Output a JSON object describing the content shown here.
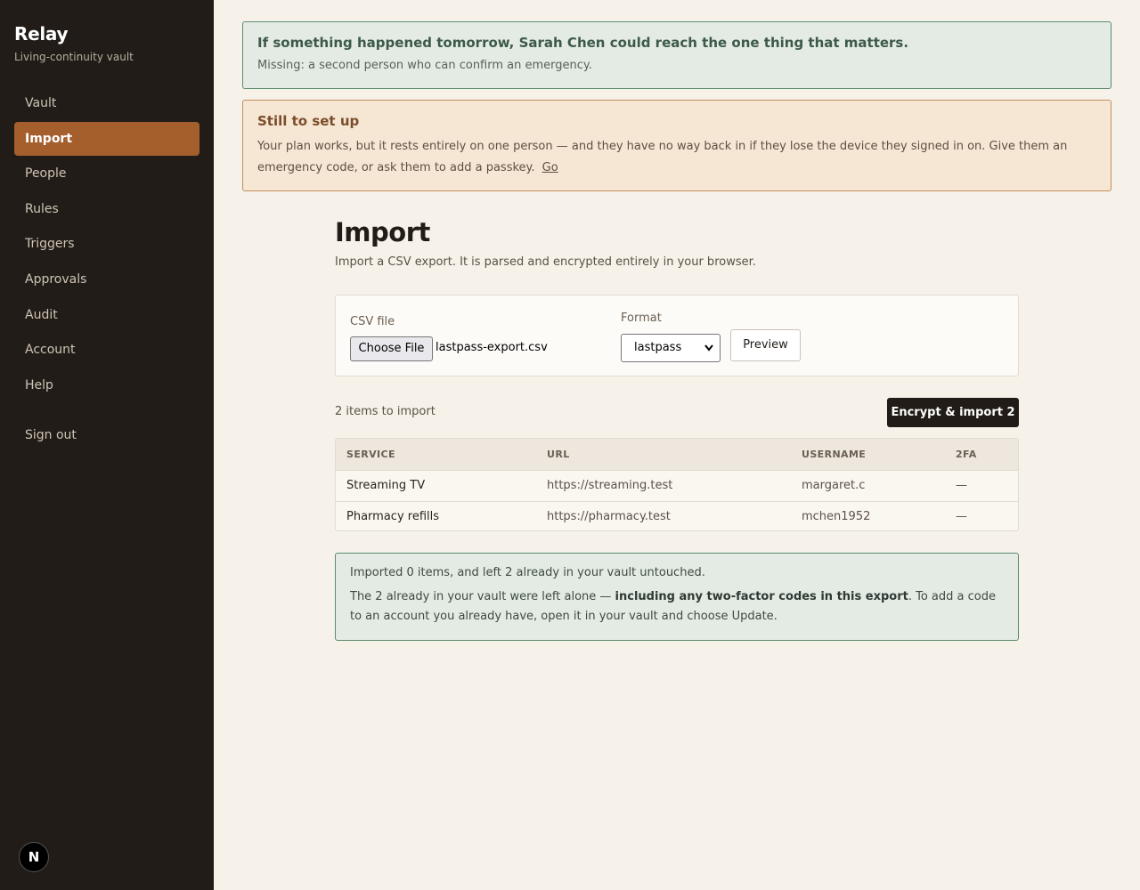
{
  "sidebar": {
    "brand": "Relay",
    "tagline": "Living-continuity vault",
    "items": [
      {
        "label": "Vault"
      },
      {
        "label": "Import",
        "active": true
      },
      {
        "label": "People"
      },
      {
        "label": "Rules"
      },
      {
        "label": "Triggers"
      },
      {
        "label": "Approvals"
      },
      {
        "label": "Audit"
      },
      {
        "label": "Account"
      },
      {
        "label": "Help"
      }
    ],
    "sign_out": "Sign out",
    "badge": "N"
  },
  "banners": {
    "status": {
      "heading": "If something happened tomorrow, Sarah Chen could reach the one thing that matters.",
      "sub": "Missing: a second person who can confirm an emergency."
    },
    "setup": {
      "heading": "Still to set up",
      "body": "Your plan works, but it rests entirely on one person — and they have no way back in if they lose the device they signed in on. Give them an emergency code, or ask them to add a passkey.",
      "link": "Go"
    }
  },
  "page": {
    "title": "Import",
    "description": "Import a CSV export. It is parsed and encrypted entirely in your browser."
  },
  "form": {
    "csv_label": "CSV file",
    "file_button": "Choose File",
    "file_name": "lastpass-export.csv",
    "format_label": "Format",
    "format_value": "lastpass",
    "preview_button": "Preview"
  },
  "import": {
    "count_text": "2 items to import",
    "encrypt_button": "Encrypt & import 2"
  },
  "table": {
    "headers": [
      "SERVICE",
      "URL",
      "USERNAME",
      "2FA"
    ],
    "rows": [
      {
        "service": "Streaming TV",
        "url": "https://streaming.test",
        "username": "margaret.c",
        "twofa": "—"
      },
      {
        "service": "Pharmacy refills",
        "url": "https://pharmacy.test",
        "username": "mchen1952",
        "twofa": "—"
      }
    ]
  },
  "result": {
    "line1": "Imported 0 items, and left 2 already in your vault untouched.",
    "line2_pre": "The 2 already in your vault were left alone — ",
    "line2_bold": "including any two-factor codes in this export",
    "line2_post": ". To add a code to an account you already have, open it in your vault and choose Update."
  },
  "colors": {
    "sidebar_bg": "#211c17",
    "accent": "#a55f2d",
    "success_border": "#5b8a6e",
    "warning_border": "#c58d5c"
  }
}
